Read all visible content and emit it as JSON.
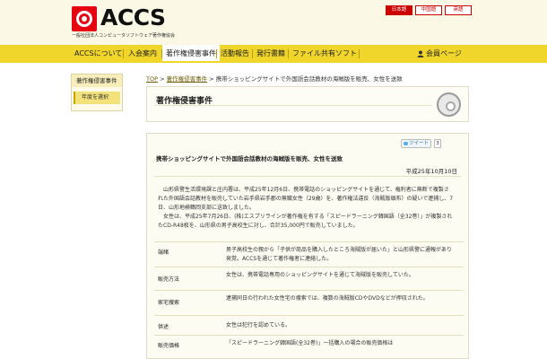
{
  "header": {
    "logo_text": "ACCS",
    "logo_subtitle": "一般社団法人コンピュータソフトウェア著作権協会",
    "languages": [
      "日本語",
      "中国語",
      "英語"
    ]
  },
  "nav": {
    "items": [
      "ACCSについて",
      "入会案内",
      "著作権侵害事件",
      "活動報告",
      "発行書籍",
      "ファイル共有ソフト",
      "会員ページ"
    ]
  },
  "sidebar": {
    "title": "著作権侵害事件",
    "items": [
      "年度を選択"
    ]
  },
  "breadcrumb": {
    "items": [
      "TOP",
      "著作権侵害事件",
      "携帯ショッピングサイトで外国語会話教材の海賊版を販売、女性を送致"
    ],
    "separator": ">"
  },
  "page_title": "著作権侵害事件",
  "article": {
    "tweet_label": "ツイート",
    "tweet_count": "3",
    "title": "携帯ショッピングサイトで外国語会話教材の海賊版を販売、女性を送致",
    "date": "平成25年10月10日",
    "paragraphs": [
      "山形県警生活環境課と庄内署は、平成25年12月6日、携帯電話のショッピングサイトを通じて、権利者に無断で複製された外国語会話教材を販売していた岩手県岩手郡の無職女性（29歳）を、著作権法違反（海賊版頒布）の疑いで逮捕し、7日、山形地検鶴岡支部に送致しました。",
      "女性は、平成25年7月26日、(株)エスプリラインが著作権を有する「スピードラーニング韓国語（全32巻）」が複製されたCD-R48枚を、山形県の男子高校生に対し、合計35,000円で販売していました。"
    ],
    "table": [
      {
        "label": "端緒",
        "value": "男子高校生の親から「子供が商品を購入したところ海賊版が届いた」と山形県警に通報があり発覚。ACCSを通じて著作権者に連絡した。"
      },
      {
        "label": "販売方法",
        "value": "女性は、携帯電話専用のショッピングサイトを通じて海賊版を販売していた。"
      },
      {
        "label": "家宅捜索",
        "value": "逮捕同日の行われた女性宅の捜索では、複数の海賊版CDやDVDなどが押収された。"
      },
      {
        "label": "供述",
        "value": "女性は犯行を認めている。"
      },
      {
        "label": "販売価格",
        "value": "「スピードラーニング韓国語(全32巻)」一括購入の場合の販売価格は"
      }
    ]
  },
  "colors": {
    "nav": "#f0d52a",
    "brand_red": "#e60012",
    "header_bg": "#fbf8e6"
  },
  "icons": [
    "accs-logo-icon",
    "disc-icon",
    "twitter-bird-icon",
    "user-icon"
  ]
}
